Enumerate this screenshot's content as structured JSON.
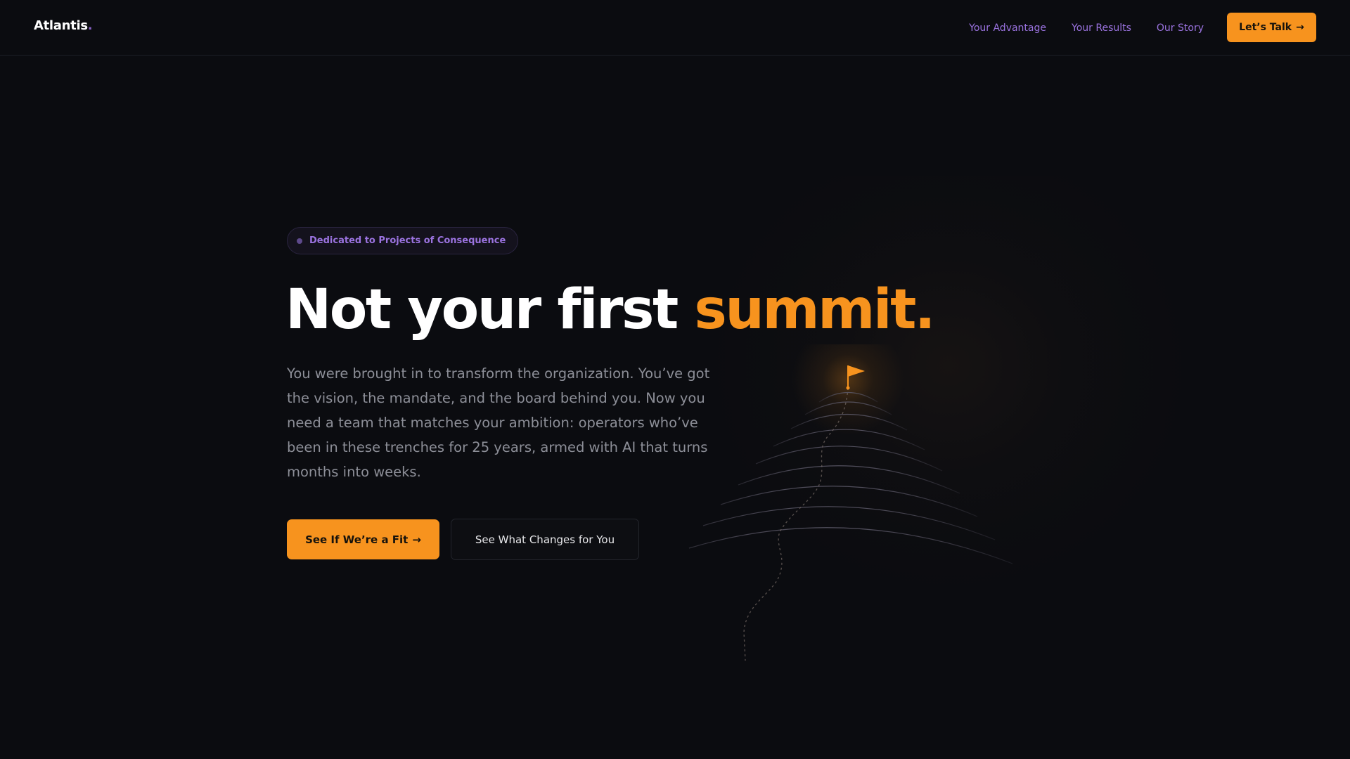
{
  "nav": {
    "logo": "Atlantis",
    "logo_dot": ".",
    "links": [
      "Your Advantage",
      "Your Results",
      "Our Story"
    ],
    "cta_label": "Let’s Talk",
    "cta_arrow": "→"
  },
  "hero": {
    "badge": "Dedicated to Projects of Consequence",
    "headline_white": "Not your first",
    "headline_accent": "summit.",
    "lede": "You were brought in to transform the organization. You’ve got the vision, the mandate, and the board behind you. Now you need a team that matches your ambition: operators who’ve been in these trenches for 25 years, armed with AI that turns months into weeks.",
    "primary_cta": "See If We’re a Fit",
    "primary_arrow": "→",
    "secondary_cta": "See What Changes for You"
  },
  "icons": {
    "flag": "flag-icon",
    "mountain": "mountain-illustration",
    "arrow": "arrow-right-icon"
  },
  "colors": {
    "background": "#0b0c10",
    "accent": "#f7931e",
    "nav_link": "#9b73e0",
    "body_text": "#8d8f98",
    "badge_dot": "#5e4a8c"
  }
}
